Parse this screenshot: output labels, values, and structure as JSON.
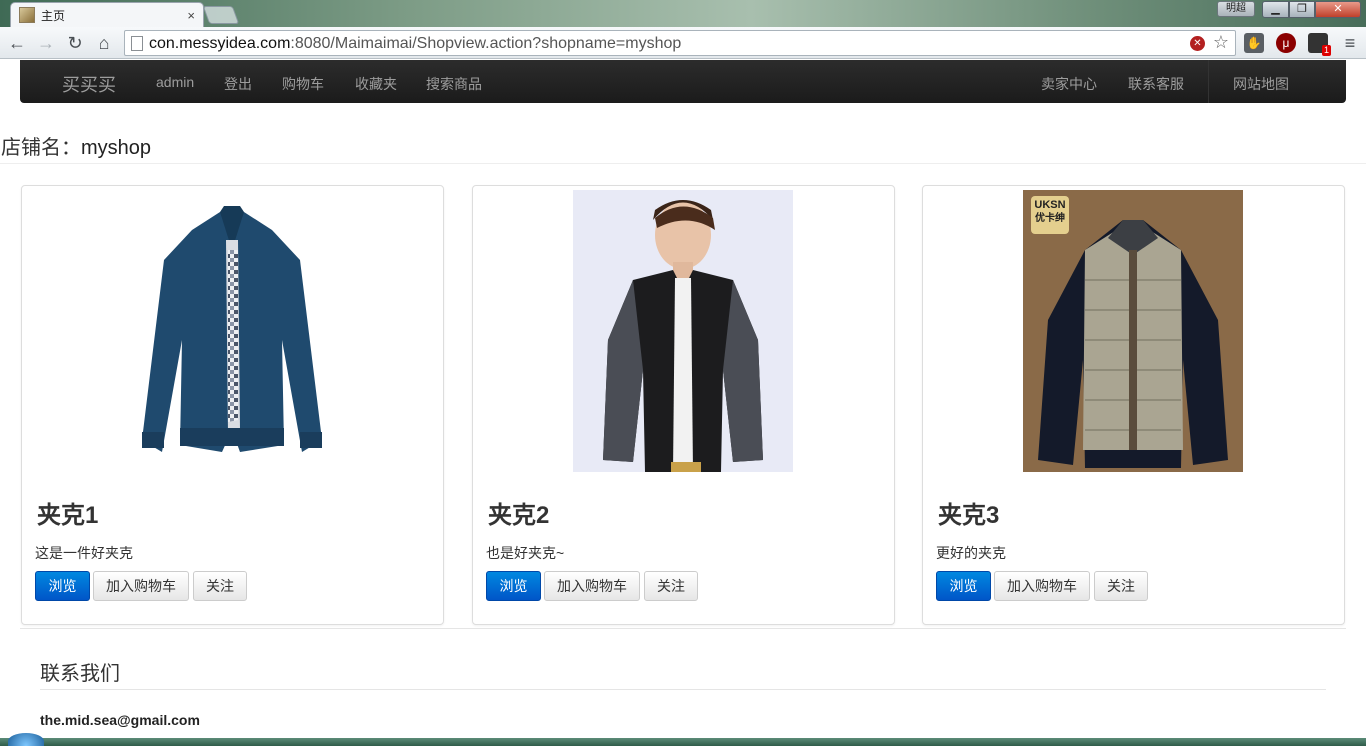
{
  "browser": {
    "tab_title": "主页",
    "tab_close": "×",
    "user_badge": "明超",
    "url_host": "con.messyidea.com",
    "url_rest": ":8080/Maimaimai/Shopview.action?shopname=myshop",
    "ext_badge": "1"
  },
  "navbar": {
    "brand": "买买买",
    "left_links": [
      "admin",
      "登出",
      "购物车",
      "收藏夹",
      "搜索商品"
    ],
    "right_links": [
      "卖家中心",
      "联系客服",
      "网站地图"
    ]
  },
  "shop": {
    "label": "店铺名：",
    "name": "myshop"
  },
  "products": [
    {
      "name": "夹克1",
      "description": "这是一件好夹克",
      "browse": "浏览",
      "add_cart": "加入购物车",
      "follow": "关注",
      "image": "blue-jacket"
    },
    {
      "name": "夹克2",
      "description": "也是好夹克~",
      "browse": "浏览",
      "add_cart": "加入购物车",
      "follow": "关注",
      "image": "leather-jacket-model"
    },
    {
      "name": "夹克3",
      "description": "更好的夹克",
      "browse": "浏览",
      "add_cart": "加入购物车",
      "follow": "关注",
      "image": "down-jacket",
      "image_logo_line1": "UKSN",
      "image_logo_line2": "优卡绅"
    }
  ],
  "footer": {
    "contact_title": "联系我们",
    "email": "the.mid.sea@gmail.com"
  },
  "colors": {
    "navbar_bg": "#222222",
    "primary_button": "#0066cc"
  }
}
